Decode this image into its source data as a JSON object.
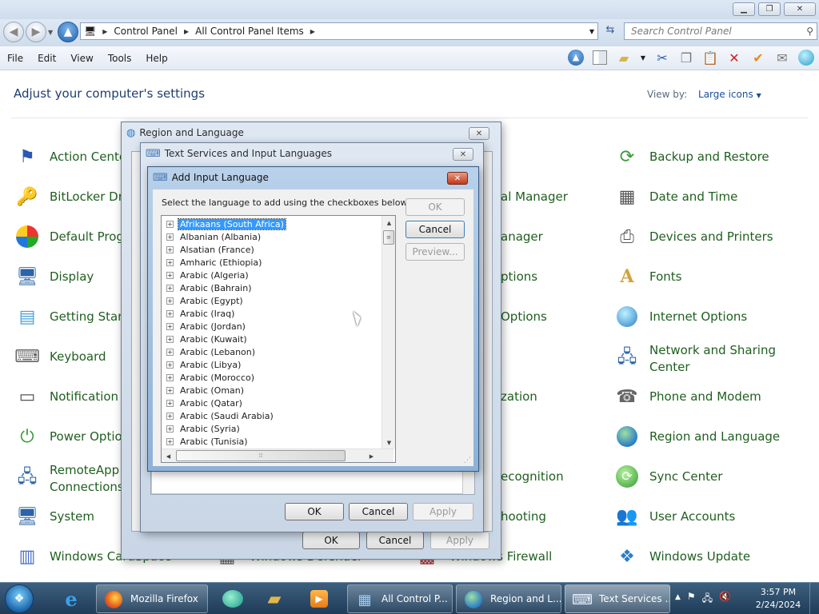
{
  "window": {
    "minimize_glyph": "▁",
    "maximize_glyph": "❐",
    "close_glyph": "✕"
  },
  "address": {
    "crumbs": [
      "Control Panel",
      "All Control Panel Items"
    ],
    "search_placeholder": "Search Control Panel"
  },
  "menu": [
    "File",
    "Edit",
    "View",
    "Tools",
    "Help"
  ],
  "toolbar_icons": [
    "up-icon",
    "panel-icon",
    "folder-icon",
    "dropdown-icon",
    "cut-icon",
    "copy-icon",
    "paste-icon",
    "delete-icon",
    "check-icon",
    "mail-icon",
    "globe-icon"
  ],
  "controlpanel": {
    "header": "Adjust your computer's settings",
    "view_by_label": "View by:",
    "view_by_value": "Large icons",
    "items_left": [
      {
        "label": "Action Cente",
        "icon": "flag-icon"
      },
      {
        "label": "BitLocker Dri",
        "icon": "bitlocker-icon"
      },
      {
        "label": "Default Prog",
        "icon": "default-programs-icon"
      },
      {
        "label": "Display",
        "icon": "display-icon"
      },
      {
        "label": "Getting Start",
        "icon": "getting-started-icon"
      },
      {
        "label": "Keyboard",
        "icon": "keyboard-icon"
      },
      {
        "label": "Notification A",
        "icon": "notification-icon"
      },
      {
        "label": "Power Optio",
        "icon": "power-icon"
      },
      {
        "label": "RemoteApp a",
        "label2": "Connections",
        "icon": "remoteapp-icon"
      },
      {
        "label": "System",
        "icon": "system-icon"
      },
      {
        "label": "Windows CardSpace",
        "icon": "cardspace-icon"
      }
    ],
    "items_mid": [
      {
        "label": "al Manager"
      },
      {
        "label": "anager"
      },
      {
        "label": "ptions"
      },
      {
        "label": "Options"
      },
      {
        "label": "zation"
      },
      {
        "label": "ecognition"
      },
      {
        "label": "hooting"
      },
      {
        "label": "Windows Defender"
      },
      {
        "label": "Windows Firewall"
      }
    ],
    "items_right": [
      {
        "label": "Backup and Restore",
        "icon": "backup-icon"
      },
      {
        "label": "Date and Time",
        "icon": "calendar-icon"
      },
      {
        "label": "Devices and Printers",
        "icon": "printer-icon"
      },
      {
        "label": "Fonts",
        "icon": "fonts-icon"
      },
      {
        "label": "Internet Options",
        "icon": "internet-options-icon"
      },
      {
        "label": "Network and Sharing",
        "label2": "Center",
        "icon": "network-icon"
      },
      {
        "label": "Phone and Modem",
        "icon": "phone-icon"
      },
      {
        "label": "Region and Language",
        "icon": "region-globe-icon"
      },
      {
        "label": "Sync Center",
        "icon": "sync-icon"
      },
      {
        "label": "User Accounts",
        "icon": "users-icon"
      },
      {
        "label": "Windows Update",
        "icon": "update-icon"
      }
    ]
  },
  "dlg_region": {
    "title": "Region and Language",
    "ok": "OK",
    "cancel": "Cancel",
    "apply": "Apply"
  },
  "dlg_text": {
    "title": "Text Services and Input Languages",
    "ok": "OK",
    "cancel": "Cancel",
    "apply": "Apply"
  },
  "dlg_add": {
    "title": "Add Input Language",
    "instruction": "Select the language to add using the checkboxes below.",
    "ok": "OK",
    "cancel": "Cancel",
    "preview": "Preview...",
    "languages": [
      "Afrikaans (South Africa)",
      "Albanian (Albania)",
      "Alsatian (France)",
      "Amharic (Ethiopia)",
      "Arabic (Algeria)",
      "Arabic (Bahrain)",
      "Arabic (Egypt)",
      "Arabic (Iraq)",
      "Arabic (Jordan)",
      "Arabic (Kuwait)",
      "Arabic (Lebanon)",
      "Arabic (Libya)",
      "Arabic (Morocco)",
      "Arabic (Oman)",
      "Arabic (Qatar)",
      "Arabic (Saudi Arabia)",
      "Arabic (Syria)",
      "Arabic (Tunisia)"
    ],
    "selected_index": 0
  },
  "taskbar": {
    "tasks": [
      {
        "label": "Mozilla Firefox",
        "icon": "firefox-icon"
      },
      {
        "label": "All Control P...",
        "icon": "control-panel-icon"
      },
      {
        "label": "Region and L...",
        "icon": "region-globe-icon"
      },
      {
        "label": "Text Services ...",
        "icon": "text-services-icon"
      }
    ],
    "time": "3:57 PM",
    "date": "2/24/2024"
  }
}
